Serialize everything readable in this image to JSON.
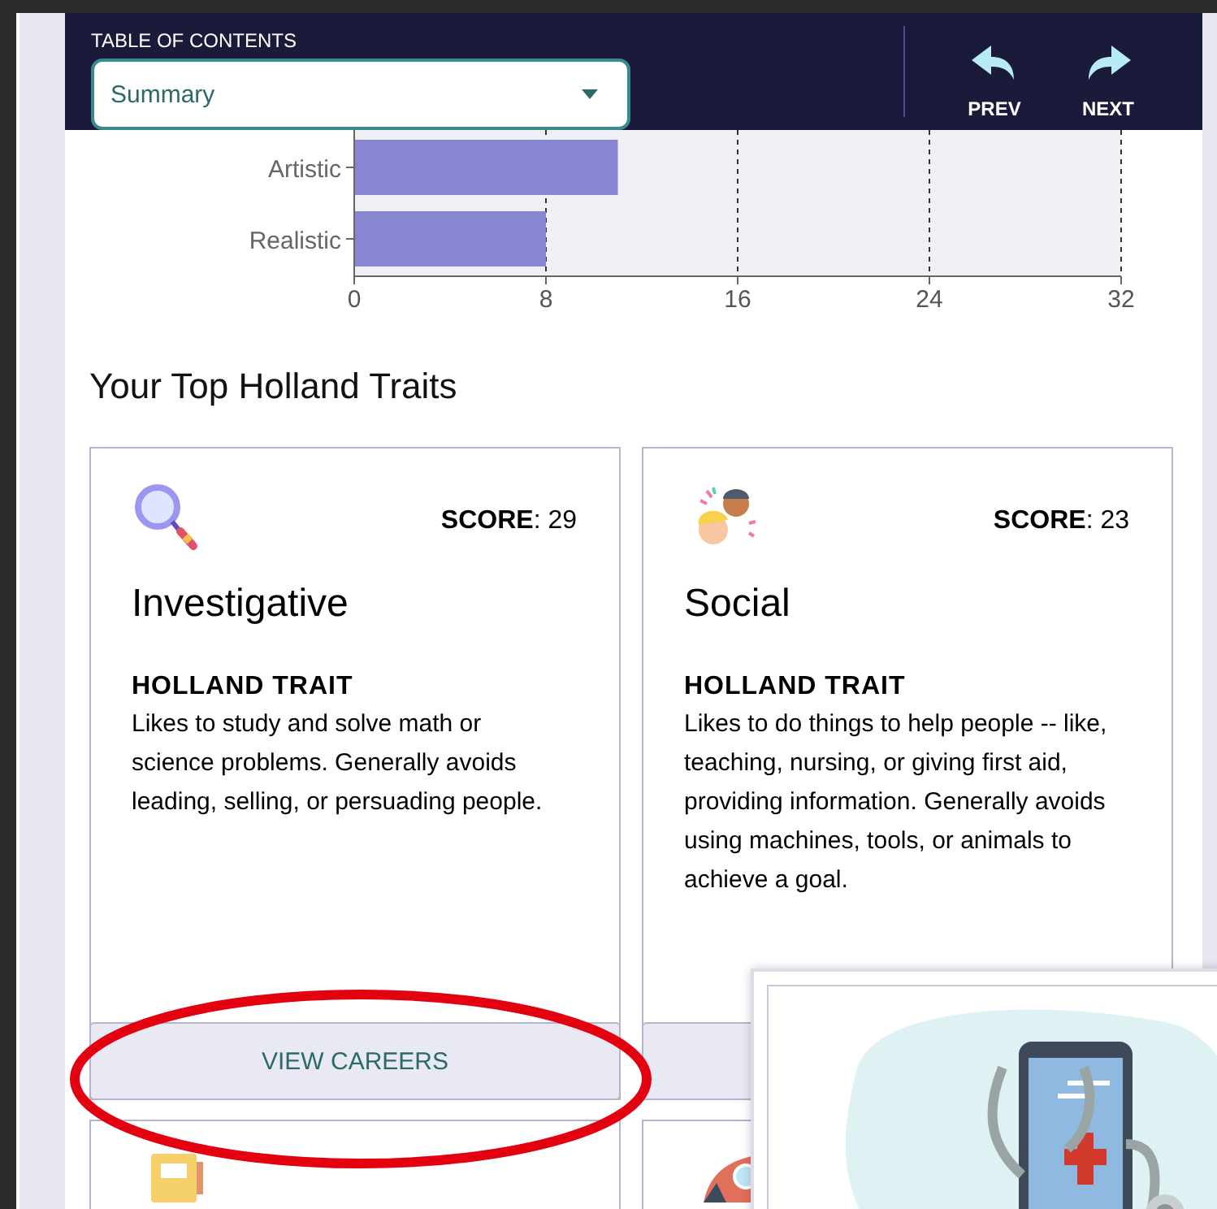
{
  "header": {
    "toc_label": "TABLE OF CONTENTS",
    "toc_select": {
      "value": "Summary"
    },
    "buttons": [
      {
        "kind": "prev",
        "label": "PREV"
      },
      {
        "kind": "next",
        "label": "NEXT"
      }
    ]
  },
  "chart": {
    "chart_data": {
      "type": "bar",
      "orientation": "horizontal",
      "grid": true,
      "categories": [
        "Artistic",
        "Realistic"
      ],
      "values": [
        11,
        8
      ],
      "xlim": [
        0,
        32
      ],
      "xticks": [
        0,
        8,
        16,
        24,
        32
      ]
    }
  },
  "section_title": "Your Top Holland Traits",
  "cards": [
    {
      "score": "**SCORE**: 29",
      "title": "Investigative",
      "trait_label": "HOLLAND TRAIT",
      "description": "Likes to study and solve math or science problems. Generally avoids leading, selling, or persuading people.",
      "button": "VIEW CAREERS"
    },
    {
      "score": "**SCORE**: 23",
      "title": "Social",
      "trait_label": "HOLLAND TRAIT",
      "description": "Likes to do things to help people -- like, teaching, nursing, or giving first aid, providing information. Generally avoids using machines, tools, or animals to achieve a goal."
    }
  ]
}
